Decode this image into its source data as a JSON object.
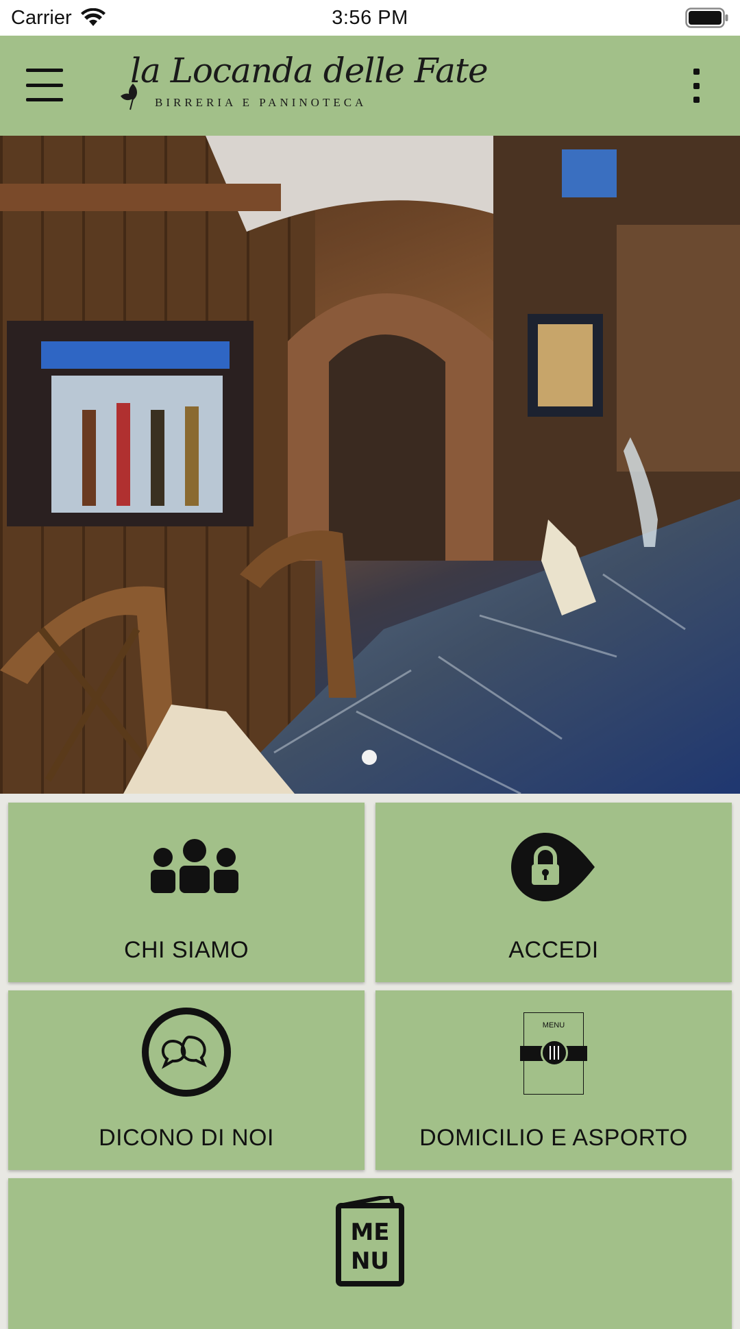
{
  "status_bar": {
    "carrier": "Carrier",
    "time": "3:56 PM"
  },
  "header": {
    "logo_script": "la Locanda delle Fate",
    "logo_subtitle": "BIRRERIA E PANINOTECA",
    "brand_color": "#a2c089"
  },
  "hero": {
    "slide_indicator_count": 1
  },
  "tiles": {
    "chi_siamo": {
      "label": "CHI SIAMO",
      "icon": "people-group-icon"
    },
    "accedi": {
      "label": "ACCEDI",
      "icon": "lock-icon"
    },
    "dicono_di_noi": {
      "label": "DICONO DI NOI",
      "icon": "chat-bubbles-icon"
    },
    "domicilio": {
      "label": "DOMICILIO E ASPORTO",
      "icon": "menu-card-icon",
      "icon_text": "MENU"
    },
    "menu": {
      "label": "MENU",
      "icon": "menu-book-icon"
    }
  }
}
